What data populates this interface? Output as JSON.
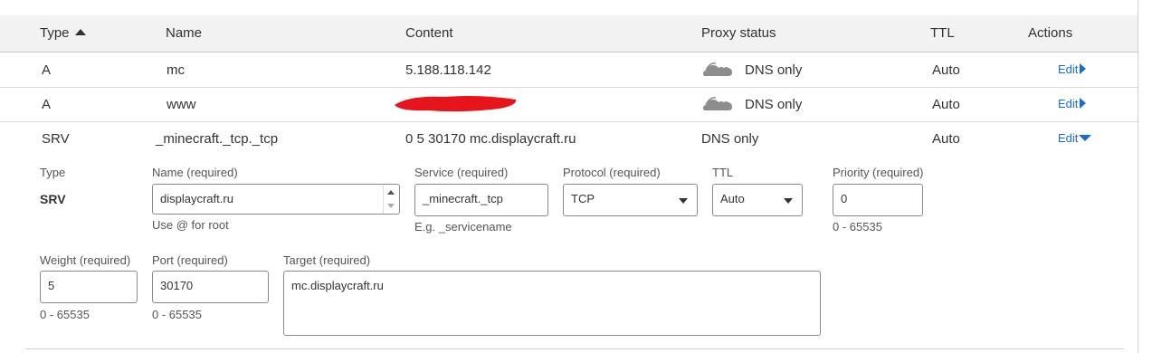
{
  "header": {
    "type": "Type",
    "name": "Name",
    "content": "Content",
    "proxy_status": "Proxy status",
    "ttl": "TTL",
    "actions": "Actions"
  },
  "records": [
    {
      "type": "A",
      "name": "mc",
      "content": "5.188.118.142",
      "proxy": "DNS only",
      "ttl": "Auto",
      "action": "Edit"
    },
    {
      "type": "A",
      "name": "www",
      "content": "",
      "proxy": "DNS only",
      "ttl": "Auto",
      "action": "Edit"
    },
    {
      "type": "SRV",
      "name": "_minecraft._tcp._tcp",
      "content": "0 5 30170 mc.displaycraft.ru",
      "proxy": "DNS only",
      "ttl": "Auto",
      "action": "Edit"
    }
  ],
  "edit_form": {
    "type_label": "Type",
    "type_value": "SRV",
    "name_label": "Name (required)",
    "name_value": "displaycraft.ru",
    "name_help": "Use @ for root",
    "service_label": "Service (required)",
    "service_value": "_minecraft._tcp",
    "service_help": "E.g. _servicename",
    "protocol_label": "Protocol (required)",
    "protocol_value": "TCP",
    "ttl_label": "TTL",
    "ttl_value": "Auto",
    "priority_label": "Priority (required)",
    "priority_value": "0",
    "priority_help": "0 - 65535",
    "weight_label": "Weight (required)",
    "weight_value": "5",
    "weight_help": "0 - 65535",
    "port_label": "Port (required)",
    "port_value": "30170",
    "port_help": "0 - 65535",
    "target_label": "Target (required)",
    "target_value": "mc.displaycraft.ru"
  },
  "colors": {
    "link": "#1a6bd1",
    "cloud": "#8d8d8d",
    "redaction": "#e8141b",
    "header_bg": "#f2f2f2"
  },
  "icons": {
    "sort": "sort-ascending-icon",
    "proxy": "dns-only-cloud-icon",
    "edit_collapsed": "caret-right-icon",
    "edit_expanded": "caret-down-icon"
  }
}
